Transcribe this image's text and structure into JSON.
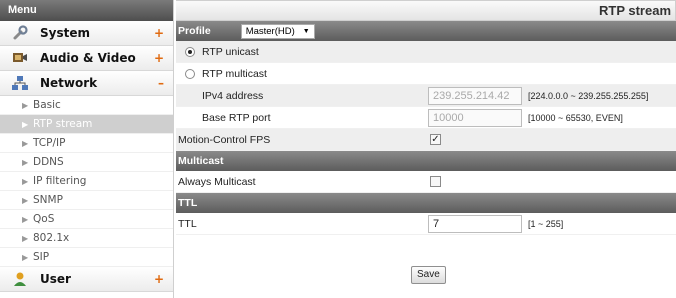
{
  "sidebar": {
    "header": "Menu",
    "categories": {
      "system": {
        "label": "System",
        "sign": "+"
      },
      "audio_video": {
        "label": "Audio & Video",
        "sign": "+"
      },
      "network": {
        "label": "Network",
        "sign": "–"
      },
      "user": {
        "label": "User",
        "sign": "+"
      }
    },
    "network_items": [
      "Basic",
      "RTP stream",
      "TCP/IP",
      "DDNS",
      "IP filtering",
      "SNMP",
      "QoS",
      "802.1x",
      "SIP"
    ]
  },
  "main": {
    "title": "RTP stream",
    "profile": {
      "label": "Profile",
      "selected": "Master(HD)"
    },
    "rtp_unicast": "RTP unicast",
    "rtp_multicast": "RTP multicast",
    "ipv4": {
      "label": "IPv4 address",
      "value": "239.255.214.42",
      "hint": "[224.0.0.0 ~ 239.255.255.255]"
    },
    "base_port": {
      "label": "Base RTP port",
      "value": "10000",
      "hint": "[10000 ~ 65530, EVEN]"
    },
    "motion_fps": {
      "label": "Motion-Control FPS",
      "checked": true
    },
    "multicast_section": "Multicast",
    "always_multicast": {
      "label": "Always Multicast",
      "checked": false
    },
    "ttl_section": "TTL",
    "ttl": {
      "label": "TTL",
      "value": "7",
      "hint": "[1 ~ 255]"
    },
    "save_label": "Save"
  }
}
